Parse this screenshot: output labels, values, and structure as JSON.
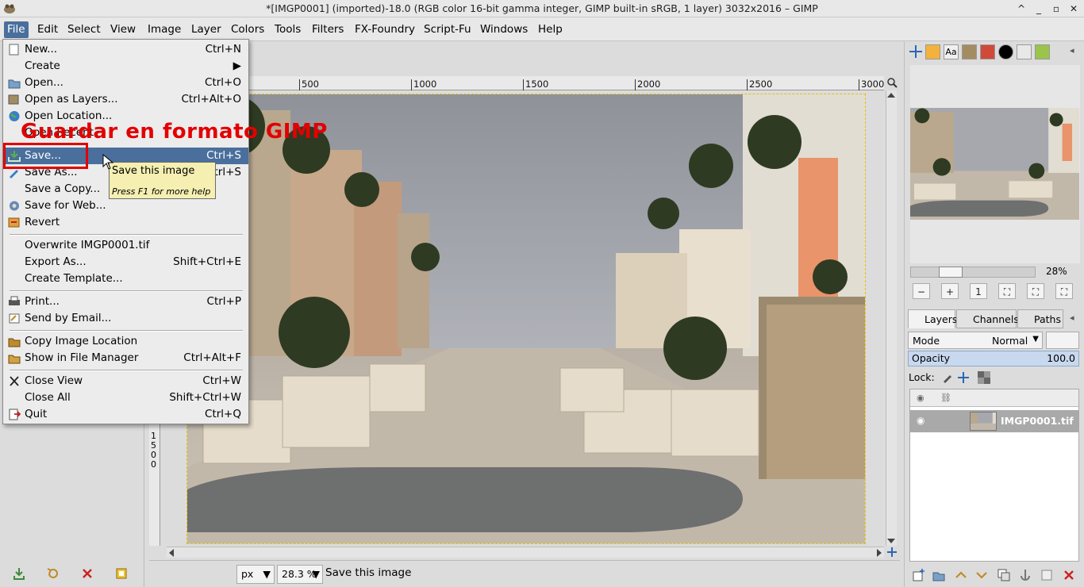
{
  "window": {
    "title": "*[IMGP0001] (imported)-18.0 (RGB color 16-bit gamma integer, GIMP built-in sRGB, 1 layer) 3032x2016 – GIMP",
    "controls": [
      "^",
      "_",
      "▫",
      "✕"
    ]
  },
  "menubar": {
    "items": [
      "File",
      "Edit",
      "Select",
      "View",
      "Image",
      "Layer",
      "Colors",
      "Tools",
      "Filters",
      "FX-Foundry",
      "Script-Fu",
      "Windows",
      "Help"
    ],
    "active": "File"
  },
  "file_menu": {
    "new": {
      "label": "New...",
      "shortcut": "Ctrl+N"
    },
    "create": {
      "label": "Create"
    },
    "open": {
      "label": "Open...",
      "shortcut": "Ctrl+O"
    },
    "open_layers": {
      "label": "Open as Layers...",
      "shortcut": "Ctrl+Alt+O"
    },
    "open_location": {
      "label": "Open Location..."
    },
    "open_recent": {
      "label": "Open Recent"
    },
    "save": {
      "label": "Save...",
      "shortcut": "Ctrl+S"
    },
    "save_as": {
      "label": "Save As...",
      "shortcut": "Shift+Ctrl+S"
    },
    "save_copy": {
      "label": "Save a Copy..."
    },
    "save_web": {
      "label": "Save for Web..."
    },
    "revert": {
      "label": "Revert"
    },
    "overwrite": {
      "label": "Overwrite IMGP0001.tif"
    },
    "export_as": {
      "label": "Export As...",
      "shortcut": "Shift+Ctrl+E"
    },
    "create_template": {
      "label": "Create Template..."
    },
    "print": {
      "label": "Print...",
      "shortcut": "Ctrl+P"
    },
    "send_email": {
      "label": "Send by Email..."
    },
    "copy_location": {
      "label": "Copy Image Location"
    },
    "show_manager": {
      "label": "Show in File Manager",
      "shortcut": "Ctrl+Alt+F"
    },
    "close_view": {
      "label": "Close View",
      "shortcut": "Ctrl+W"
    },
    "close_all": {
      "label": "Close All",
      "shortcut": "Shift+Ctrl+W"
    },
    "quit": {
      "label": "Quit",
      "shortcut": "Ctrl+Q"
    }
  },
  "annotation": {
    "text": "Guardar en formato GIMP",
    "color": "#e30000"
  },
  "tooltip": {
    "main": "Save this image",
    "help": "Press F1 for more help"
  },
  "ruler": {
    "ticks": [
      "500",
      "1000",
      "1500",
      "2000",
      "2500",
      "3000"
    ],
    "vertical_label": "1500"
  },
  "statusbar": {
    "unit": "px",
    "zoom": "28.3 %",
    "message": "Save this image"
  },
  "navigation": {
    "zoom_percent": "28%",
    "zoom_fraction": 0.28
  },
  "layers_panel": {
    "tabs": [
      "Layers",
      "Channels",
      "Paths"
    ],
    "mode_label": "Mode",
    "mode_value": "Normal",
    "opacity_label": "Opacity",
    "opacity_value": "100.0",
    "lock_label": "Lock:",
    "layer_name": "IMGP0001.tif"
  },
  "colors": {
    "menu_highlight": "#4a6f9c",
    "annotation_red": "#e30000",
    "tooltip_bg": "#f5efb2"
  }
}
